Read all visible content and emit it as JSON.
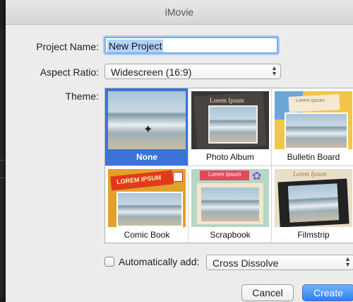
{
  "window": {
    "title": "iMovie"
  },
  "form": {
    "project_name_label": "Project Name:",
    "project_name_value": "New Project",
    "aspect_ratio_label": "Aspect Ratio:",
    "aspect_ratio_value": "Widescreen (16:9)",
    "theme_label": "Theme:"
  },
  "themes": [
    {
      "label": "None",
      "selected": true
    },
    {
      "label": "Photo Album",
      "selected": false,
      "overlay_text": "Lorem Ipsum"
    },
    {
      "label": "Bulletin Board",
      "selected": false,
      "overlay_text": "Lorem Ipsum"
    },
    {
      "label": "Comic Book",
      "selected": false,
      "overlay_text": "LOREM IPSUM"
    },
    {
      "label": "Scrapbook",
      "selected": false,
      "overlay_text": "Lorem Ipsum"
    },
    {
      "label": "Filmstrip",
      "selected": false,
      "overlay_text": "Lorem Ipsum"
    }
  ],
  "auto_add": {
    "label": "Automatically add:",
    "checked": false,
    "value": "Cross Dissolve"
  },
  "buttons": {
    "cancel": "Cancel",
    "create": "Create"
  },
  "colors": {
    "selection": "#3b73d9",
    "default_button": "#2e7ff2"
  }
}
